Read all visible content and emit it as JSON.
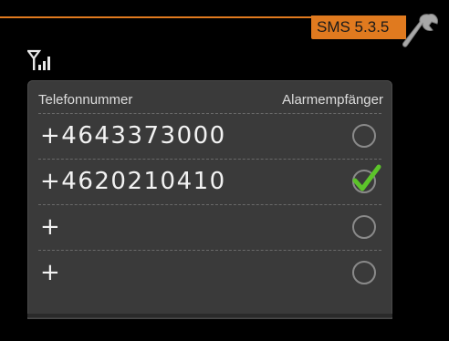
{
  "menu": {
    "label": "SMS 5.3.5",
    "accent_color": "#e07a1f"
  },
  "status": {
    "signal_icon": "signal-antenna-icon"
  },
  "wrench_icon": "wrench-icon",
  "table": {
    "col_phone": "Telefonnummer",
    "col_alarm": "Alarmempfänger",
    "rows": [
      {
        "number": "+4643373000",
        "alarm_receiver": false
      },
      {
        "number": "+4620210410",
        "alarm_receiver": true
      },
      {
        "number": "+",
        "alarm_receiver": false
      },
      {
        "number": "+",
        "alarm_receiver": false
      }
    ]
  },
  "colors": {
    "check": "#5cc42a",
    "panel": "#3a3a3a"
  }
}
